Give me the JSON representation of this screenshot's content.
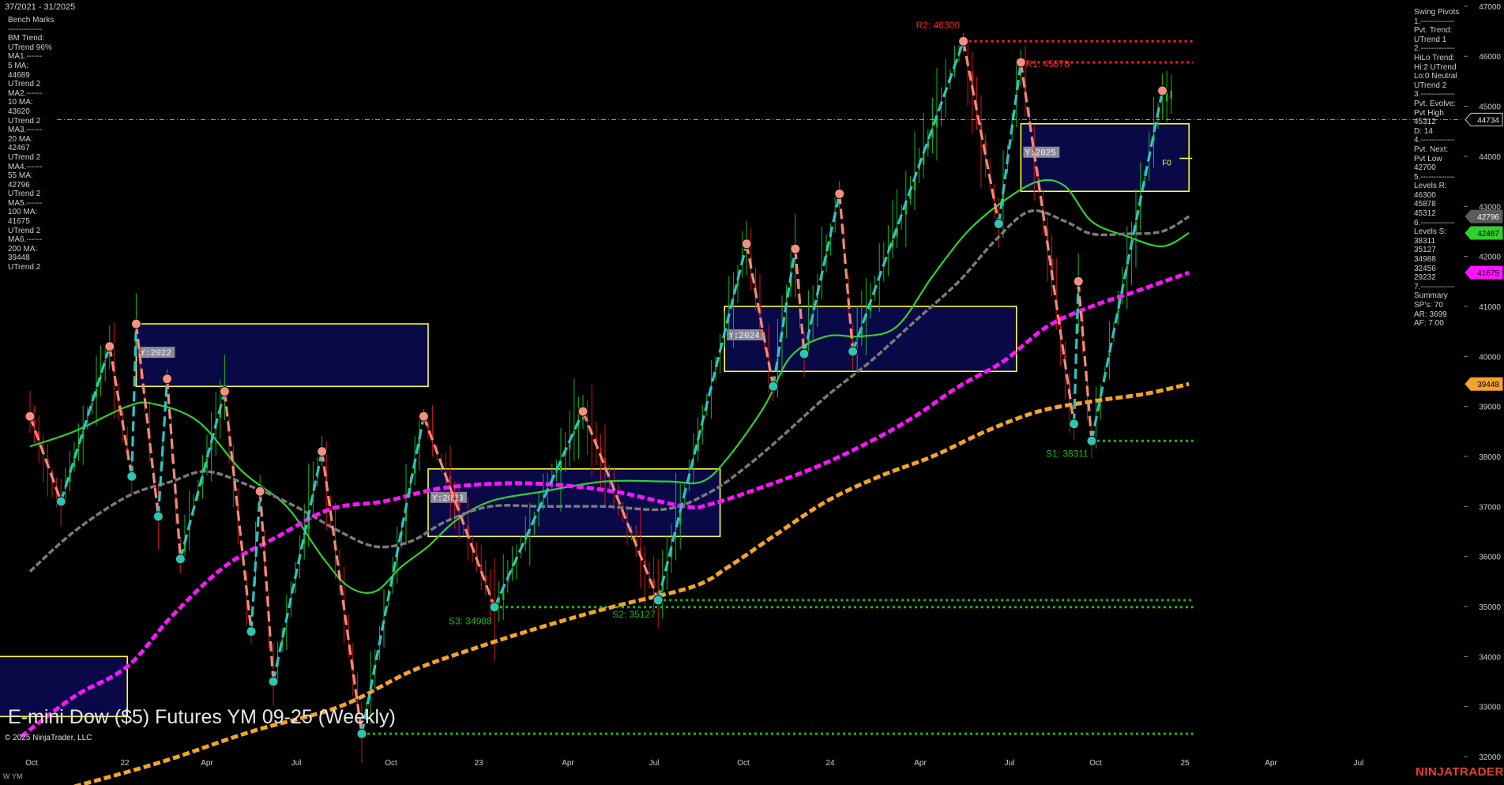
{
  "header": {
    "date_range": "37/2021 - 31/2025"
  },
  "title": "E-mini Dow ($5) Futures YM 09-25 (Weekly)",
  "copyright": "© 2025 NinjaTrader, LLC",
  "instrument_tag": "W YM",
  "brand": "NINJATRADER",
  "colors": {
    "background": "#000000",
    "ma_10": "#2fd12f",
    "ma_20": "#7a7a7a",
    "ma_100": "#ff14ff",
    "ma_200": "#f2a42a",
    "swing_up": "#2ec4c4",
    "swing_down": "#f08c78",
    "box_border": "#ffff33",
    "box_fill": "#0a0a55",
    "resistance": "#ff2020",
    "support": "#18b818",
    "last_price": "#cfcfcf",
    "brand": "#e8402a"
  },
  "benchmarks": {
    "lines": [
      "Bench Marks",
      "-------------",
      "BM Trend:",
      "UTrend 96%",
      "MA1.------",
      "5 MA:",
      "44689",
      "UTrend 2",
      "MA2.------",
      "10 MA:",
      "43620",
      "UTrend 2",
      "MA3.------",
      "20 MA:",
      "42467",
      "UTrend 2",
      "MA4.------",
      "55 MA:",
      "42796",
      "UTrend 2",
      "MA5.------",
      "100 MA:",
      "41675",
      "UTrend 2",
      "MA6.------",
      "200 MA:",
      "39448",
      "UTrend 2"
    ]
  },
  "swing_pivots": {
    "lines": [
      "Swing Pivots",
      "1.-------------",
      "Pvt. Trend:",
      "UTrend 1",
      "2.-------------",
      "HiLo Trend:",
      "Hi:2 UTrend",
      "Lo:0 Neutral",
      "UTrend 2",
      "3.-------------",
      "Pvt. Evolve:",
      "Pvt High",
      "45312",
      "D: 14",
      "4.-------------",
      "Pvt. Next:",
      "Pvt Low",
      "42700",
      "5.-------------",
      "Levels R:",
      "46300",
      "45878",
      "45312",
      "6.-------------",
      "Levels S:",
      "38311",
      "35127",
      "34988",
      "32456",
      "29232",
      "7.-------------",
      "Summary",
      "SP's: 70",
      "AR: 3699",
      "AF: 7.00"
    ]
  },
  "chart_data": {
    "type": "candlestick",
    "timeframe": "Weekly",
    "ylim": [
      31400,
      47100
    ],
    "y_ticks": [
      32000,
      33000,
      34000,
      35000,
      36000,
      37000,
      38000,
      39000,
      40000,
      41000,
      42000,
      43000,
      44000,
      45000,
      46000,
      47000
    ],
    "x_labels": [
      "Oct",
      "22",
      "Apr",
      "Jul",
      "Oct",
      "23",
      "Apr",
      "Jul",
      "Oct",
      "24",
      "Apr",
      "Jul",
      "Oct",
      "25",
      "Apr",
      "Jul"
    ],
    "last_price": 44734,
    "price_tags": [
      {
        "value": 44734,
        "style": "last"
      },
      {
        "value": 42796,
        "style": "ma55"
      },
      {
        "value": 42467,
        "style": "ma20"
      },
      {
        "value": 41675,
        "style": "ma100"
      },
      {
        "value": 39448,
        "style": "ma200"
      }
    ],
    "swing_pivots": [
      {
        "week": 0,
        "type": "high",
        "value": 38800
      },
      {
        "week": 7,
        "type": "low",
        "value": 37100
      },
      {
        "week": 18,
        "type": "high",
        "value": 40200
      },
      {
        "week": 23,
        "type": "low",
        "value": 37600
      },
      {
        "week": 24,
        "type": "high",
        "value": 40650
      },
      {
        "week": 29,
        "type": "low",
        "value": 36800
      },
      {
        "week": 31,
        "type": "high",
        "value": 39550
      },
      {
        "week": 34,
        "type": "low",
        "value": 35950
      },
      {
        "week": 44,
        "type": "high",
        "value": 39300
      },
      {
        "week": 50,
        "type": "low",
        "value": 34500
      },
      {
        "week": 52,
        "type": "high",
        "value": 37300
      },
      {
        "week": 55,
        "type": "low",
        "value": 33500
      },
      {
        "week": 66,
        "type": "high",
        "value": 38100
      },
      {
        "week": 75,
        "type": "low",
        "value": 32456
      },
      {
        "week": 89,
        "type": "high",
        "value": 38800
      },
      {
        "week": 105,
        "type": "low",
        "value": 34988
      },
      {
        "week": 125,
        "type": "high",
        "value": 38900
      },
      {
        "week": 142,
        "type": "low",
        "value": 35127
      },
      {
        "week": 162,
        "type": "high",
        "value": 42250
      },
      {
        "week": 168,
        "type": "low",
        "value": 39400
      },
      {
        "week": 173,
        "type": "high",
        "value": 42150
      },
      {
        "week": 175,
        "type": "low",
        "value": 40050
      },
      {
        "week": 183,
        "type": "high",
        "value": 43250
      },
      {
        "week": 186,
        "type": "low",
        "value": 40100
      },
      {
        "week": 211,
        "type": "high",
        "value": 46300
      },
      {
        "week": 219,
        "type": "low",
        "value": 42650
      },
      {
        "week": 224,
        "type": "high",
        "value": 45878
      },
      {
        "week": 236,
        "type": "low",
        "value": 38650
      },
      {
        "week": 237,
        "type": "high",
        "value": 41500
      },
      {
        "week": 240,
        "type": "low",
        "value": 38311
      },
      {
        "week": 256,
        "type": "high",
        "value": 45312
      }
    ],
    "levels": [
      {
        "name": "R2",
        "label": "R2: 46300",
        "value": 46300,
        "kind": "resistance",
        "from_week": 211
      },
      {
        "name": "R1",
        "label": "R1: 45878",
        "value": 45878,
        "kind": "resistance",
        "from_week": 224
      },
      {
        "name": "S1",
        "label": "S1: 38311",
        "value": 38311,
        "kind": "support",
        "from_week": 240
      },
      {
        "name": "S2",
        "label": "S2: 35127",
        "value": 35127,
        "kind": "support",
        "from_week": 142
      },
      {
        "name": "S3",
        "label": "S3: 34988",
        "value": 34988,
        "kind": "support",
        "from_week": 105
      },
      {
        "name": "S4",
        "label": "",
        "value": 32456,
        "kind": "support",
        "from_week": 75
      }
    ],
    "year_boxes": [
      {
        "label": "Y:2022",
        "high": 40650,
        "low": 39400,
        "from_week": 24,
        "to_week": 90
      },
      {
        "label": "Y:2023",
        "high": 37750,
        "low": 36400,
        "from_week": 90,
        "to_week": 156
      },
      {
        "label": "Y:2024",
        "high": 41000,
        "low": 39700,
        "from_week": 157,
        "to_week": 223
      },
      {
        "label": "Y:2025",
        "high": 44650,
        "low": 43300,
        "from_week": 224,
        "to_week": 262
      },
      {
        "label": "",
        "high": 34000,
        "low": 32800,
        "from_week": -23,
        "to_week": 22
      }
    ],
    "f0_label": "F0",
    "moving_averages": [
      {
        "name": "10 MA",
        "color_key": "ma_10",
        "points": [
          [
            0,
            38200
          ],
          [
            10,
            38500
          ],
          [
            22,
            39000
          ],
          [
            28,
            39050
          ],
          [
            38,
            38700
          ],
          [
            48,
            37700
          ],
          [
            58,
            37000
          ],
          [
            66,
            36000
          ],
          [
            72,
            35400
          ],
          [
            78,
            35300
          ],
          [
            84,
            35800
          ],
          [
            90,
            36200
          ],
          [
            96,
            36700
          ],
          [
            104,
            37100
          ],
          [
            116,
            37300
          ],
          [
            130,
            37500
          ],
          [
            144,
            37500
          ],
          [
            152,
            37500
          ],
          [
            158,
            38000
          ],
          [
            166,
            39000
          ],
          [
            172,
            40000
          ],
          [
            180,
            40400
          ],
          [
            188,
            40400
          ],
          [
            196,
            40600
          ],
          [
            204,
            41600
          ],
          [
            212,
            42500
          ],
          [
            220,
            43100
          ],
          [
            228,
            43500
          ],
          [
            234,
            43400
          ],
          [
            240,
            42700
          ],
          [
            248,
            42400
          ],
          [
            256,
            42200
          ],
          [
            262,
            42467
          ]
        ]
      },
      {
        "name": "20 MA",
        "color_key": "ma_20",
        "points": [
          [
            0,
            35700
          ],
          [
            10,
            36500
          ],
          [
            22,
            37200
          ],
          [
            32,
            37500
          ],
          [
            40,
            37700
          ],
          [
            50,
            37400
          ],
          [
            60,
            37000
          ],
          [
            70,
            36500
          ],
          [
            78,
            36200
          ],
          [
            86,
            36300
          ],
          [
            94,
            36700
          ],
          [
            104,
            37000
          ],
          [
            116,
            37000
          ],
          [
            130,
            37000
          ],
          [
            144,
            36950
          ],
          [
            154,
            37300
          ],
          [
            162,
            37800
          ],
          [
            170,
            38400
          ],
          [
            180,
            39200
          ],
          [
            190,
            39900
          ],
          [
            200,
            40700
          ],
          [
            210,
            41500
          ],
          [
            218,
            42300
          ],
          [
            226,
            42900
          ],
          [
            234,
            42700
          ],
          [
            240,
            42450
          ],
          [
            248,
            42450
          ],
          [
            256,
            42500
          ],
          [
            262,
            42796
          ]
        ]
      },
      {
        "name": "100 MA",
        "color_key": "ma_100",
        "points": [
          [
            -2,
            32400
          ],
          [
            10,
            33200
          ],
          [
            22,
            33800
          ],
          [
            32,
            34800
          ],
          [
            44,
            35800
          ],
          [
            56,
            36400
          ],
          [
            68,
            36950
          ],
          [
            80,
            37100
          ],
          [
            92,
            37350
          ],
          [
            104,
            37450
          ],
          [
            116,
            37450
          ],
          [
            132,
            37300
          ],
          [
            148,
            37000
          ],
          [
            154,
            37050
          ],
          [
            166,
            37400
          ],
          [
            178,
            37800
          ],
          [
            190,
            38300
          ],
          [
            200,
            38800
          ],
          [
            210,
            39400
          ],
          [
            220,
            39900
          ],
          [
            230,
            40600
          ],
          [
            240,
            41000
          ],
          [
            250,
            41300
          ],
          [
            262,
            41675
          ]
        ]
      },
      {
        "name": "200 MA",
        "color_key": "ma_200",
        "points": [
          [
            10,
            31400
          ],
          [
            30,
            31900
          ],
          [
            50,
            32500
          ],
          [
            70,
            33000
          ],
          [
            86,
            33700
          ],
          [
            100,
            34150
          ],
          [
            116,
            34600
          ],
          [
            132,
            35000
          ],
          [
            150,
            35400
          ],
          [
            158,
            35800
          ],
          [
            168,
            36400
          ],
          [
            180,
            37100
          ],
          [
            192,
            37600
          ],
          [
            204,
            38000
          ],
          [
            216,
            38500
          ],
          [
            228,
            38900
          ],
          [
            240,
            39100
          ],
          [
            252,
            39250
          ],
          [
            262,
            39448
          ]
        ]
      }
    ]
  }
}
